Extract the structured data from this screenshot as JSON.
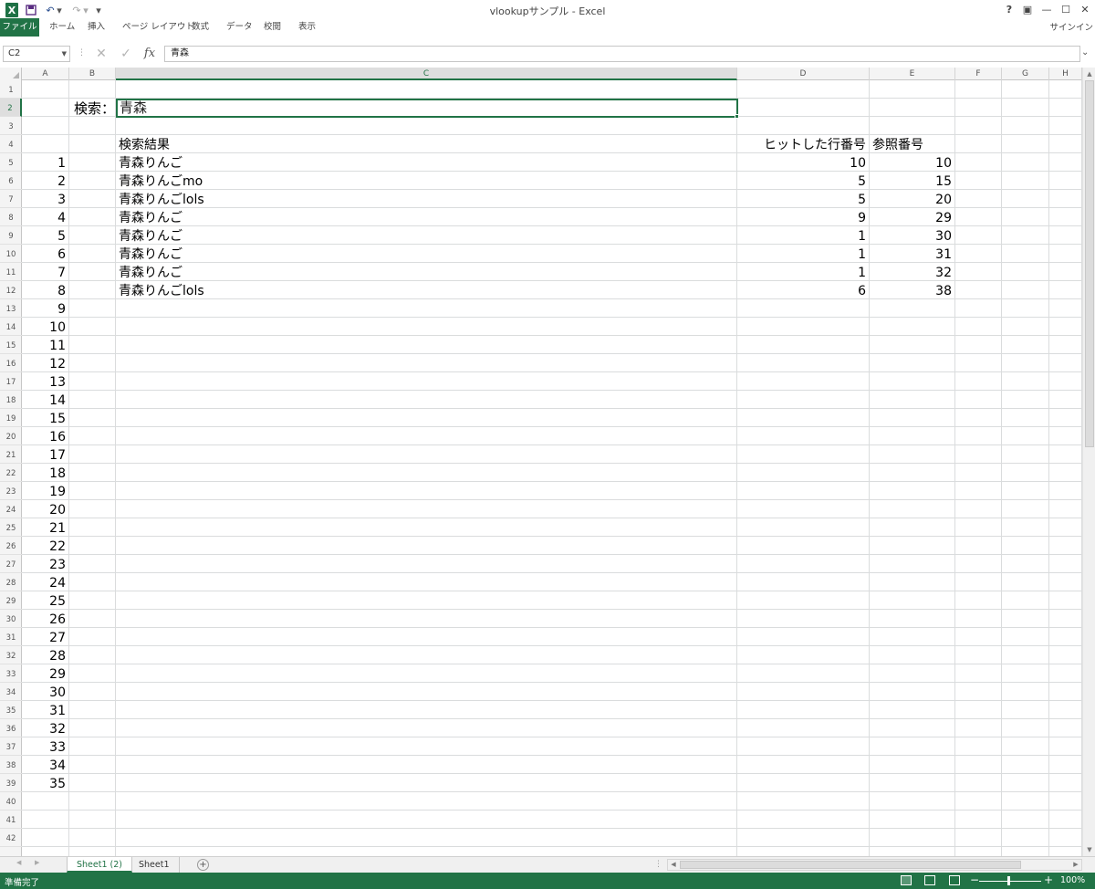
{
  "window": {
    "title": "vlookupサンプル - Excel",
    "help": "?",
    "ribbon_display": "▣",
    "minimize": "—",
    "maximize": "☐",
    "close": "✕"
  },
  "quick_access": {
    "logo": "X",
    "save_icon": "save-icon",
    "undo_icon": "undo-icon",
    "redo_icon": "redo-icon"
  },
  "ribbon": {
    "tabs": [
      "ファイル",
      "ホーム",
      "挿入",
      "ページ レイアウト",
      "数式",
      "データ",
      "校閲",
      "表示"
    ],
    "signin": "サインイン"
  },
  "formula_bar": {
    "name_box": "C2",
    "cancel": "✕",
    "enter": "✓",
    "fx": "fx",
    "value": "青森"
  },
  "columns": [
    "A",
    "B",
    "C",
    "D",
    "E",
    "F",
    "G",
    "H"
  ],
  "selected_column": "C",
  "selected_row": 2,
  "row_numbers": [
    1,
    2,
    3,
    4,
    5,
    6,
    7,
    8,
    9,
    10,
    11,
    12,
    13,
    14,
    15,
    16,
    17,
    18,
    19,
    20,
    21,
    22,
    23,
    24,
    25,
    26,
    27,
    28,
    29,
    30,
    31,
    32,
    33,
    34,
    35,
    36,
    37,
    38,
    39,
    40,
    41,
    42
  ],
  "sheet": {
    "search_label": "検索：",
    "search_value": "青森",
    "headers": {
      "result": "検索結果",
      "hit_row": "ヒットした行番号",
      "ref_no": "参照番号"
    },
    "results": [
      {
        "result": "青森りんご",
        "hit_row": "10",
        "ref_no": "10"
      },
      {
        "result": "青森りんごmo",
        "hit_row": "5",
        "ref_no": "15"
      },
      {
        "result": "青森りんごlols",
        "hit_row": "5",
        "ref_no": "20"
      },
      {
        "result": "青森りんご",
        "hit_row": "9",
        "ref_no": "29"
      },
      {
        "result": "青森りんご",
        "hit_row": "1",
        "ref_no": "30"
      },
      {
        "result": "青森りんご",
        "hit_row": "1",
        "ref_no": "31"
      },
      {
        "result": "青森りんご",
        "hit_row": "1",
        "ref_no": "32"
      },
      {
        "result": "青森りんごlols",
        "hit_row": "6",
        "ref_no": "38"
      }
    ],
    "index_numbers": [
      "1",
      "2",
      "3",
      "4",
      "5",
      "6",
      "7",
      "8",
      "9",
      "10",
      "11",
      "12",
      "13",
      "14",
      "15",
      "16",
      "17",
      "18",
      "19",
      "20",
      "21",
      "22",
      "23",
      "24",
      "25",
      "26",
      "27",
      "28",
      "29",
      "30",
      "31",
      "32",
      "33",
      "34",
      "35"
    ]
  },
  "sheet_tabs": [
    "Sheet1 (2)",
    "Sheet1"
  ],
  "active_sheet": "Sheet1 (2)",
  "status": {
    "text": "準備完了",
    "zoom": "100%",
    "zoom_minus": "−",
    "zoom_plus": "+"
  },
  "colors": {
    "accent": "#217346",
    "gridline": "#dadcdd",
    "header_bg": "#f4f4f4"
  }
}
